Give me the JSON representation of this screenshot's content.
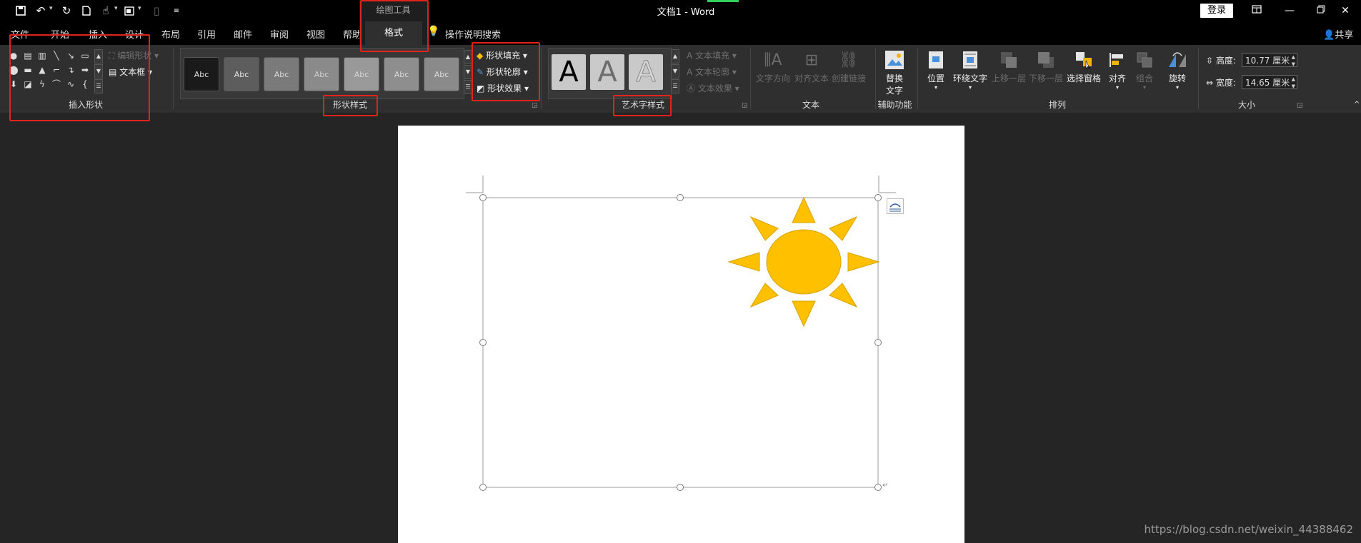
{
  "app": {
    "doc_title": "文档1  -  Word",
    "login_label": "登录",
    "share_label": "共享"
  },
  "quick_access": {
    "icons": [
      "save-icon",
      "undo-icon",
      "redo-icon",
      "new-doc-icon",
      "touch-mode-icon",
      "print-layout-icon",
      "disabled-icon",
      "customize-icon"
    ]
  },
  "tabs": {
    "items": [
      "文件",
      "开始",
      "插入",
      "设计",
      "布局",
      "引用",
      "邮件",
      "审阅",
      "视图",
      "帮助"
    ],
    "context_group": "绘图工具",
    "format": "格式",
    "tell_me": "操作说明搜索"
  },
  "ribbon": {
    "insert_shapes": {
      "edit_shape": "编辑形状",
      "text_box": "文本框",
      "group_label": "插入形状"
    },
    "shape_styles": {
      "tile_label": "Abc",
      "tiles": [
        {
          "bg": "#1a1a1a",
          "fg": "#e0e0e0"
        },
        {
          "bg": "#5d5d5d",
          "fg": "#e6e6e6"
        },
        {
          "bg": "#7a7a7a",
          "fg": "#dcdcdc"
        },
        {
          "bg": "#8a8a8a",
          "fg": "#d0d0d0"
        },
        {
          "bg": "#999999",
          "fg": "#d6d6d6"
        },
        {
          "bg": "#8e8e8e",
          "fg": "#dadada"
        },
        {
          "bg": "#8a8a8a",
          "fg": "#dddddd"
        }
      ],
      "fill": "形状填充",
      "outline": "形状轮廓",
      "effects": "形状效果",
      "group_label": "形状样式"
    },
    "wordart": {
      "letter": "A",
      "text_fill": "文本填充",
      "text_outline": "文本轮廓",
      "text_effects": "文本效果",
      "group_label": "艺术字样式"
    },
    "text": {
      "direction": "文字方向",
      "align": "对齐文本",
      "link": "创建链接",
      "group_label": "文本"
    },
    "accessibility": {
      "alt_text_line1": "替换",
      "alt_text_line2": "文字",
      "group_label": "辅助功能"
    },
    "arrange": {
      "position": "位置",
      "wrap": "环绕文字",
      "forward": "上移一层",
      "backward": "下移一层",
      "selection_pane": "选择窗格",
      "align": "对齐",
      "group": "组合",
      "rotate": "旋转",
      "group_label": "排列"
    },
    "size": {
      "height_label": "高度:",
      "height_value": "10.77 厘米",
      "width_label": "宽度:",
      "width_value": "14.65 厘米",
      "group_label": "大小"
    }
  },
  "colors": {
    "sun_fill": "#ffc000",
    "sun_stroke": "#d9a300",
    "annotation_red": "#e0231b"
  },
  "watermark": "https://blog.csdn.net/weixin_44388462"
}
